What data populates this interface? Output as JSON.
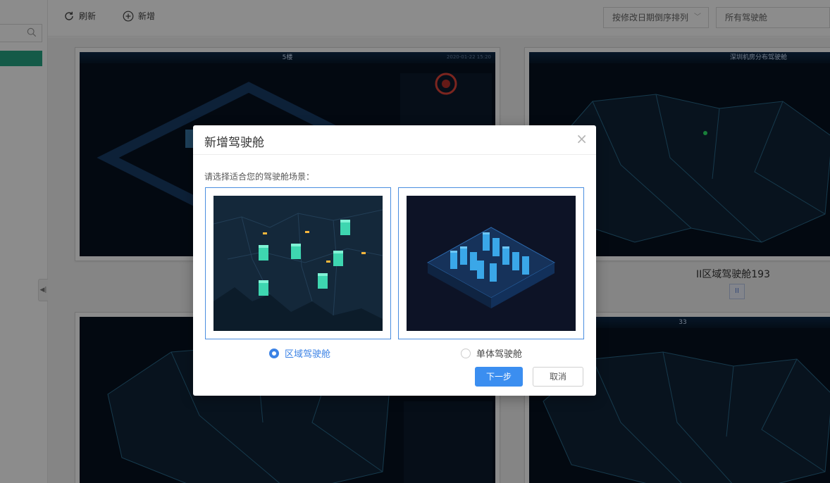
{
  "toolbar": {
    "refresh_label": "刷新",
    "add_label": "新增",
    "sort_select": "按修改日期倒序排列",
    "filter_select": "所有驾驶舱"
  },
  "cards": [
    {
      "screen_title": "5楼",
      "timestamp": "2020-01-22 15:20"
    },
    {
      "screen_title": "深圳机房分布驾驶舱",
      "name": "II区域驾驶舱193",
      "badge": "II"
    },
    {
      "screen_title": ""
    },
    {
      "screen_title": "33"
    }
  ],
  "modal": {
    "title": "新增驾驶舱",
    "prompt": "请选择适合您的驾驶舱场景：",
    "options": [
      {
        "label": "区域驾驶舱",
        "selected": true
      },
      {
        "label": "单体驾驶舱",
        "selected": false
      }
    ],
    "next_label": "下一步",
    "cancel_label": "取消"
  },
  "colors": {
    "accent": "#3b8ef0",
    "sidebar_active": "#26a483",
    "dashboard_bg": "#07111f"
  }
}
